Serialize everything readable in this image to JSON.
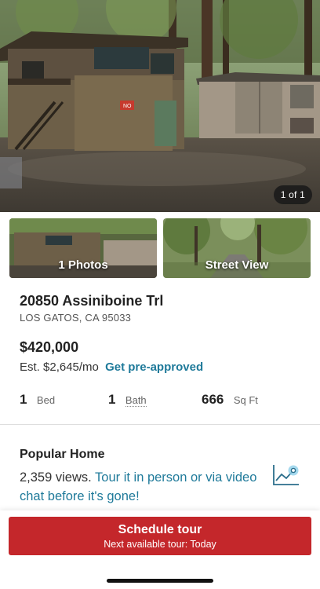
{
  "hero": {
    "counter": "1 of 1",
    "sign_text": "NO"
  },
  "thumbnails": [
    {
      "label": "1 Photos"
    },
    {
      "label": "Street View"
    }
  ],
  "listing": {
    "address": "20850 Assiniboine Trl",
    "city_state_zip": "LOS GATOS, CA 95033",
    "price": "$420,000",
    "estimate": "Est. $2,645/mo",
    "preapproved_link": "Get pre-approved",
    "stats": [
      {
        "value": "1",
        "label": "Bed"
      },
      {
        "value": "1",
        "label": "Bath"
      },
      {
        "value": "666",
        "label": "Sq Ft"
      }
    ]
  },
  "popular": {
    "title": "Popular Home",
    "views": "2,359 views.",
    "cta_link": "Tour it in person or via video chat before it's gone!",
    "icon": "chart-trend-icon"
  },
  "tour_button": {
    "label": "Schedule tour",
    "sublabel": "Next available tour: Today"
  },
  "colors": {
    "accent_red": "#c4272b",
    "link_teal": "#1f7a9a"
  }
}
